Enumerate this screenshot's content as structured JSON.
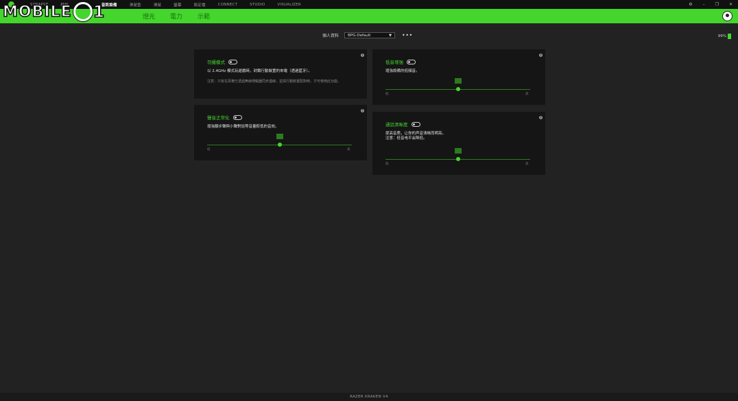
{
  "titlebar": {
    "nav": [
      "SYNAPSE",
      "鍵盤",
      "",
      "音訊設備",
      "滑鼠墊",
      "滑鼠",
      "螢幕",
      "設定檔",
      "CONNECT",
      "STUDIO",
      "VISUALIZER"
    ],
    "active_nav": "音訊設備",
    "controls": [
      "⚙",
      "–",
      "❐",
      "✕"
    ]
  },
  "subnav": {
    "tabs": [
      "",
      "",
      "燈光",
      "電力",
      "示範"
    ]
  },
  "watermark": {
    "text": "MOBILE",
    "number": "1"
  },
  "profile": {
    "label": "個人資料",
    "selected": "BPG-Default",
    "more": "•••"
  },
  "battery": {
    "text": "99%"
  },
  "cards": {
    "game_mode": {
      "title": "勿擾模式",
      "desc": "以 2.4GHz 模式玩遊戲時，封鎖行動裝置的來電（透過藍牙）。",
      "note": "注意：只有在耳麥已透過無線傳輸器同步連線，並與行動裝置配對時，才可使用此功能。"
    },
    "sound_normalization": {
      "title": "聲音正常化",
      "desc": "增強腳步聲與小聲對話等音量較低的音效。",
      "low": "低",
      "high": "高"
    },
    "bass_boost": {
      "title": "低音增強",
      "desc": "增強設備的低頻音。",
      "low": "低",
      "high": "高"
    },
    "voice_clarity": {
      "title": "通話清晰度",
      "desc1": "提高音质，让你的声音清晰而明亮。",
      "desc2": "注意：低音电平会降低。",
      "low": "低",
      "high": "高"
    }
  },
  "sliders": {
    "sound_normalization": 0.5,
    "bass_boost": 0.5,
    "voice_clarity": 0.5
  },
  "footer": {
    "device": "RAZER KRAKEN V4"
  },
  "colors": {
    "accent": "#44d62c",
    "background": "#222222",
    "card": "#151515"
  }
}
